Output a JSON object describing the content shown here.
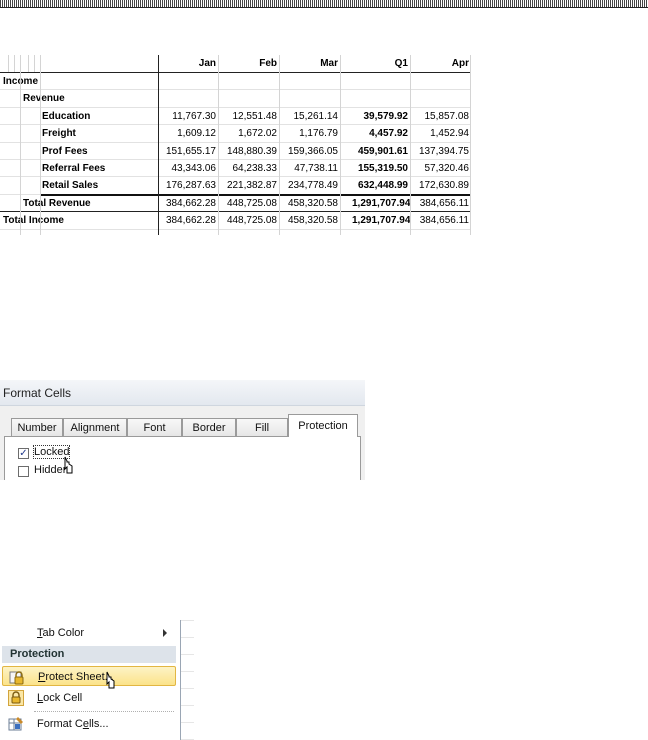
{
  "sheet": {
    "headers": [
      "Jan",
      "Feb",
      "Mar",
      "Q1",
      "Apr"
    ],
    "rows": [
      {
        "label": "Income",
        "indent": 0,
        "values": [
          "",
          "",
          "",
          "",
          ""
        ]
      },
      {
        "label": "Revenue",
        "indent": 1,
        "values": [
          "",
          "",
          "",
          "",
          ""
        ]
      },
      {
        "label": "Education",
        "indent": 2,
        "values": [
          "11,767.30",
          "12,551.48",
          "15,261.14",
          "39,579.92",
          "15,857.08"
        ]
      },
      {
        "label": "Freight",
        "indent": 2,
        "values": [
          "1,609.12",
          "1,672.02",
          "1,176.79",
          "4,457.92",
          "1,452.94"
        ]
      },
      {
        "label": "Prof Fees",
        "indent": 2,
        "values": [
          "151,655.17",
          "148,880.39",
          "159,366.05",
          "459,901.61",
          "137,394.75"
        ]
      },
      {
        "label": "Referral Fees",
        "indent": 2,
        "values": [
          "43,343.06",
          "64,238.33",
          "47,738.11",
          "155,319.50",
          "57,320.46"
        ]
      },
      {
        "label": "Retail Sales",
        "indent": 2,
        "values": [
          "176,287.63",
          "221,382.87",
          "234,778.49",
          "632,448.99",
          "172,630.89"
        ]
      },
      {
        "label": "Total Revenue",
        "indent": 1,
        "values": [
          "384,662.28",
          "448,725.08",
          "458,320.58",
          "1,291,707.94",
          "384,656.11"
        ]
      },
      {
        "label": "Total Income",
        "indent": 0,
        "values": [
          "384,662.28",
          "448,725.08",
          "458,320.58",
          "1,291,707.94",
          "384,656.11"
        ]
      }
    ]
  },
  "dialog": {
    "title": "Format Cells",
    "tabs": [
      "Number",
      "Alignment",
      "Font",
      "Border",
      "Fill",
      "Protection"
    ],
    "active_tab": "Protection",
    "locked_label": "Locked",
    "locked_checked": true,
    "hidden_label": "Hidden",
    "hidden_checked": false
  },
  "menu": {
    "tab_color": "Tab Color",
    "section": "Protection",
    "protect_sheet": "Protect Sheet...",
    "lock_cell": "Lock Cell",
    "format_cells": "Format Cells..."
  },
  "icons": {
    "submenu_arrow": "chevron-right-icon",
    "protect_sheet": "lock-sheet-icon",
    "lock_cell": "padlock-icon",
    "format_cells": "format-cells-icon",
    "cursor": "mouse-pointer-icon"
  }
}
